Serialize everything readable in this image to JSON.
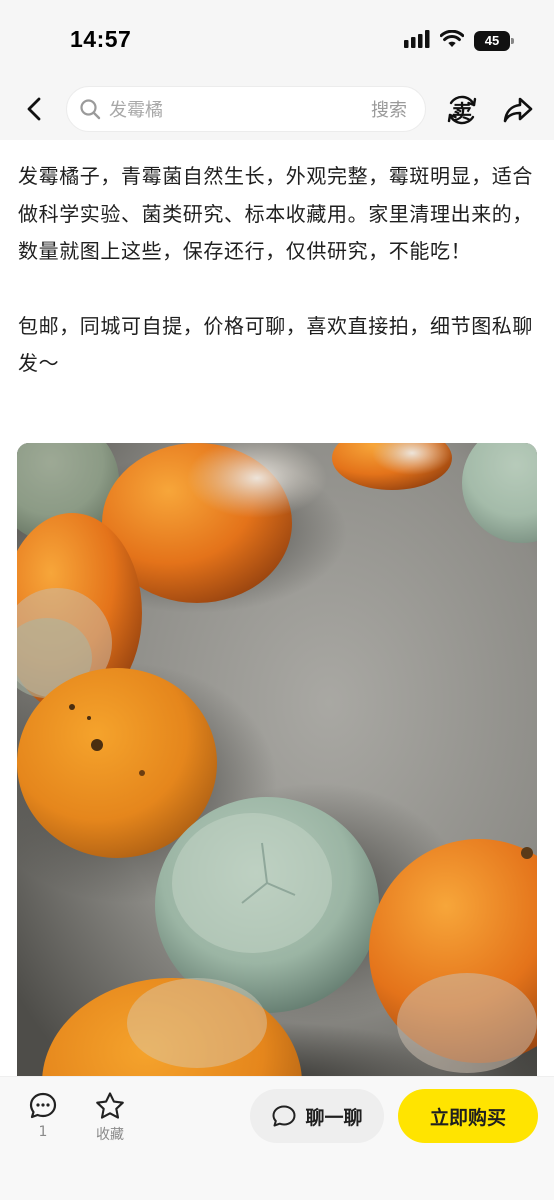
{
  "status_bar": {
    "time": "14:57",
    "battery": "45"
  },
  "nav": {
    "search_placeholder": "发霉橘",
    "search_button": "搜索",
    "sell_label": "卖"
  },
  "description": {
    "paragraph1": "发霉橘子，青霉菌自然生长，外观完整，霉斑明显，适合做科学实验、菌类研究、标本收藏用。家里清理出来的，数量就图上这些，保存还行，仅供研究，不能吃！",
    "paragraph2": "包邮，同城可自提，价格可聊，喜欢直接拍，细节图私聊发～"
  },
  "photo": {
    "subject": "moldy-oranges"
  },
  "bottom_bar": {
    "comment_count": "1",
    "favorite_label": "收藏",
    "chat_label": "聊一聊",
    "buy_label": "立即购买"
  },
  "colors": {
    "accent_yellow": "#ffe400",
    "background": "#ffffff",
    "header_bg": "#f6f6f6",
    "text_primary": "#1f1f1f",
    "text_muted": "#8a8a8a"
  },
  "icons": [
    "signal-icon",
    "wifi-icon",
    "battery-icon",
    "back-arrow-icon",
    "search-icon",
    "sell-icon",
    "share-icon",
    "comment-icon",
    "star-icon",
    "chat-bubble-icon"
  ]
}
